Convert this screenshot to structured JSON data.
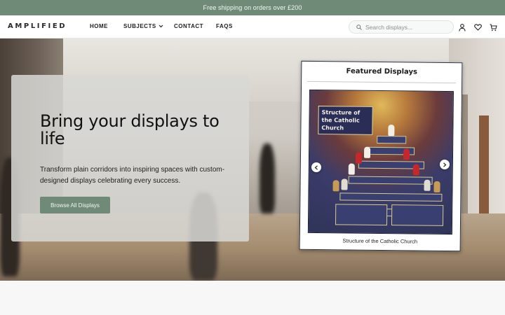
{
  "announcement": {
    "text": "Free shipping on orders over £200"
  },
  "header": {
    "logo": "AMPLIFIED",
    "nav": {
      "home": "HOME",
      "subjects": "SUBJECTS",
      "contact": "CONTACT",
      "faqs": "FAQS"
    },
    "search": {
      "placeholder": "Search displays...",
      "value": ""
    },
    "icons": [
      "user-icon",
      "heart-icon",
      "cart-icon"
    ]
  },
  "hero": {
    "title": "Bring your displays to life",
    "subtitle": "Transform plain corridors into inspiring spaces with custom-designed displays celebrating every success.",
    "cta_label": "Browse All Displays"
  },
  "featured": {
    "heading": "Featured Displays",
    "slide": {
      "poster_title": "Structure of the Catholic Church",
      "caption": "Structure of the Catholic Church"
    },
    "prev_icon": "chevron-left-icon",
    "next_icon": "chevron-right-icon"
  },
  "colors": {
    "accent": "#6f8b78",
    "poster_navy": "#2a2d56"
  }
}
